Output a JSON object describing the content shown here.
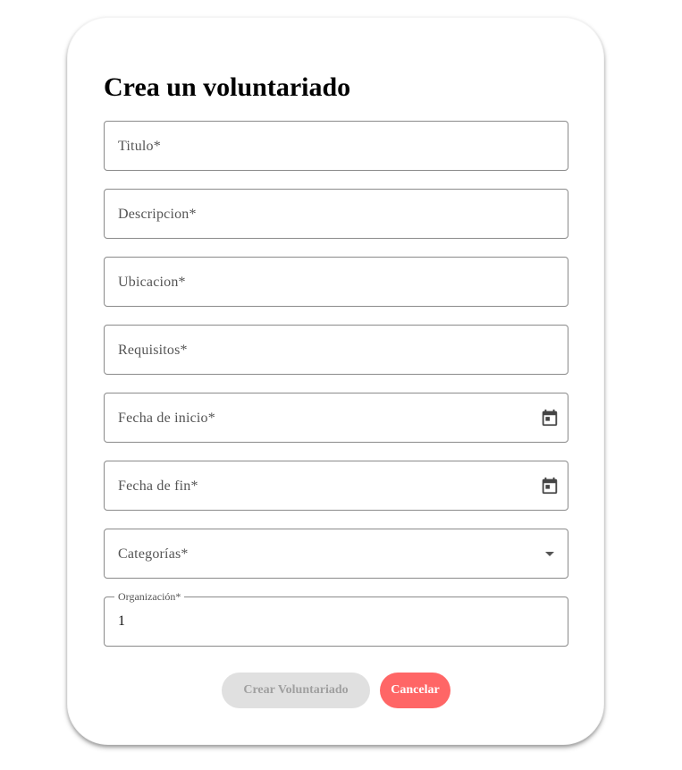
{
  "form": {
    "title": "Crea un voluntariado",
    "fields": {
      "titulo": {
        "label": "Titulo*"
      },
      "descripcion": {
        "label": "Descripcion*"
      },
      "ubicacion": {
        "label": "Ubicacion*"
      },
      "requisitos": {
        "label": "Requisitos*"
      },
      "fecha_inicio": {
        "label": "Fecha de inicio*",
        "icon": "calendar-icon"
      },
      "fecha_fin": {
        "label": "Fecha de fin*",
        "icon": "calendar-icon"
      },
      "categorias": {
        "label": "Categorías*",
        "icon": "dropdown-arrow-icon"
      },
      "organizacion": {
        "label": "Organización*",
        "value": "1"
      }
    },
    "buttons": {
      "create_label": "Crear Voluntariado",
      "cancel_label": "Cancelar"
    }
  },
  "colors": {
    "cancel_button": "#ff6666",
    "create_button_disabled": "#e0e0e0",
    "field_border": "#8a8a8a"
  }
}
